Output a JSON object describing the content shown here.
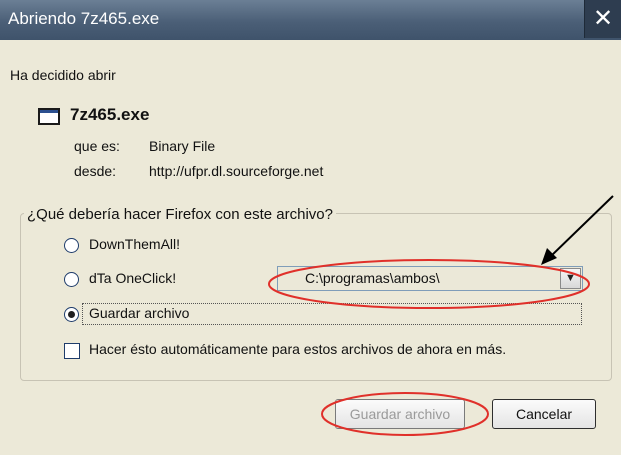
{
  "window": {
    "title": "Abriendo 7z465.exe",
    "close_glyph": "✕"
  },
  "dialog": {
    "decided_text": "Ha decidido abrir",
    "file_icon": "exe-window-icon",
    "file_name": "7z465.exe",
    "type_label": "que es:",
    "type_value": "Binary File",
    "from_label": "desde:",
    "from_value": "http://ufpr.dl.sourceforge.net",
    "question": "¿Qué debería hacer Firefox con este archivo?",
    "options": [
      {
        "label": "DownThemAll!",
        "checked": false
      },
      {
        "label": "dTa OneClick!",
        "checked": false
      },
      {
        "label": "Guardar archivo",
        "checked": true
      }
    ],
    "oneclick_folder": "C:\\programas\\ambos\\",
    "auto_checkbox_label": "Hacer ésto automáticamente para estos archivos de ahora en más.",
    "auto_checked": false,
    "save_button": "Guardar archivo",
    "cancel_button": "Cancelar"
  },
  "annotations": {
    "highlight_color": "#e0302a",
    "arrow_color": "#000000"
  }
}
